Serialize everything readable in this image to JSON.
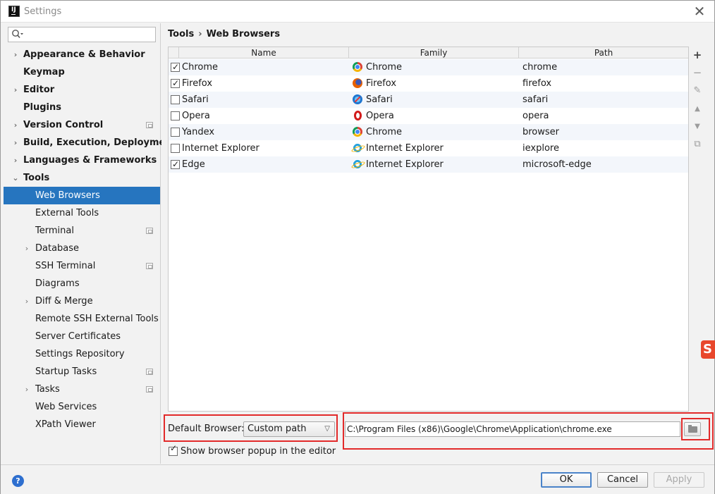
{
  "window": {
    "title": "Settings",
    "close_symbol": "✕"
  },
  "sidebar": {
    "search_placeholder": "",
    "items": [
      {
        "label": "Appearance & Behavior",
        "level": 0,
        "bold": true,
        "arrow": "›",
        "project": false,
        "selected": false
      },
      {
        "label": "Keymap",
        "level": 0,
        "bold": true,
        "arrow": "",
        "project": false,
        "selected": false
      },
      {
        "label": "Editor",
        "level": 0,
        "bold": true,
        "arrow": "›",
        "project": false,
        "selected": false
      },
      {
        "label": "Plugins",
        "level": 0,
        "bold": true,
        "arrow": "",
        "project": false,
        "selected": false
      },
      {
        "label": "Version Control",
        "level": 0,
        "bold": true,
        "arrow": "›",
        "project": true,
        "selected": false
      },
      {
        "label": "Build, Execution, Deployment",
        "level": 0,
        "bold": true,
        "arrow": "›",
        "project": false,
        "selected": false
      },
      {
        "label": "Languages & Frameworks",
        "level": 0,
        "bold": true,
        "arrow": "›",
        "project": false,
        "selected": false
      },
      {
        "label": "Tools",
        "level": 0,
        "bold": true,
        "arrow": "⌄",
        "project": false,
        "selected": false
      },
      {
        "label": "Web Browsers",
        "level": 1,
        "bold": false,
        "arrow": "",
        "project": false,
        "selected": true
      },
      {
        "label": "External Tools",
        "level": 1,
        "bold": false,
        "arrow": "",
        "project": false,
        "selected": false
      },
      {
        "label": "Terminal",
        "level": 1,
        "bold": false,
        "arrow": "",
        "project": true,
        "selected": false
      },
      {
        "label": "Database",
        "level": 1,
        "bold": false,
        "arrow": "›",
        "project": false,
        "selected": false
      },
      {
        "label": "SSH Terminal",
        "level": 1,
        "bold": false,
        "arrow": "",
        "project": true,
        "selected": false
      },
      {
        "label": "Diagrams",
        "level": 1,
        "bold": false,
        "arrow": "",
        "project": false,
        "selected": false
      },
      {
        "label": "Diff & Merge",
        "level": 1,
        "bold": false,
        "arrow": "›",
        "project": false,
        "selected": false
      },
      {
        "label": "Remote SSH External Tools",
        "level": 1,
        "bold": false,
        "arrow": "",
        "project": false,
        "selected": false
      },
      {
        "label": "Server Certificates",
        "level": 1,
        "bold": false,
        "arrow": "",
        "project": false,
        "selected": false
      },
      {
        "label": "Settings Repository",
        "level": 1,
        "bold": false,
        "arrow": "",
        "project": false,
        "selected": false
      },
      {
        "label": "Startup Tasks",
        "level": 1,
        "bold": false,
        "arrow": "",
        "project": true,
        "selected": false
      },
      {
        "label": "Tasks",
        "level": 1,
        "bold": false,
        "arrow": "›",
        "project": true,
        "selected": false
      },
      {
        "label": "Web Services",
        "level": 1,
        "bold": false,
        "arrow": "",
        "project": false,
        "selected": false
      },
      {
        "label": "XPath Viewer",
        "level": 1,
        "bold": false,
        "arrow": "",
        "project": false,
        "selected": false
      }
    ]
  },
  "breadcrumb": {
    "parent": "Tools",
    "separator": "›",
    "current": "Web Browsers"
  },
  "table": {
    "columns": [
      "Name",
      "Family",
      "Path"
    ],
    "rows": [
      {
        "checked": true,
        "name": "Chrome",
        "family": "Chrome",
        "family_icon": "chrome-icon",
        "path": "chrome"
      },
      {
        "checked": true,
        "name": "Firefox",
        "family": "Firefox",
        "family_icon": "firefox-icon",
        "path": "firefox"
      },
      {
        "checked": false,
        "name": "Safari",
        "family": "Safari",
        "family_icon": "safari-icon",
        "path": "safari"
      },
      {
        "checked": false,
        "name": "Opera",
        "family": "Opera",
        "family_icon": "opera-icon",
        "path": "opera"
      },
      {
        "checked": false,
        "name": "Yandex",
        "family": "Chrome",
        "family_icon": "chrome-icon",
        "path": "browser"
      },
      {
        "checked": false,
        "name": "Internet Explorer",
        "family": "Internet Explorer",
        "family_icon": "internet-explorer-icon",
        "path": "iexplore"
      },
      {
        "checked": true,
        "name": "Edge",
        "family": "Internet Explorer",
        "family_icon": "internet-explorer-icon",
        "path": "microsoft-edge"
      }
    ]
  },
  "toolbar": {
    "add_symbol": "+",
    "remove_symbol": "−",
    "edit_symbol": "✎",
    "up_symbol": "▲",
    "down_symbol": "▼",
    "copy_symbol": "⧉"
  },
  "default_browser": {
    "label": "Default Browser:",
    "selected": "Custom path",
    "path": "C:\\Program Files (x86)\\Google\\Chrome\\Application\\chrome.exe"
  },
  "popup": {
    "checked": true,
    "label": "Show browser popup in the editor"
  },
  "footer": {
    "help_symbol": "?",
    "ok_label": "OK",
    "cancel_label": "Cancel",
    "apply_label": "Apply"
  },
  "colors": {
    "selection": "#2675bf",
    "highlight_box": "#e22a2a"
  }
}
